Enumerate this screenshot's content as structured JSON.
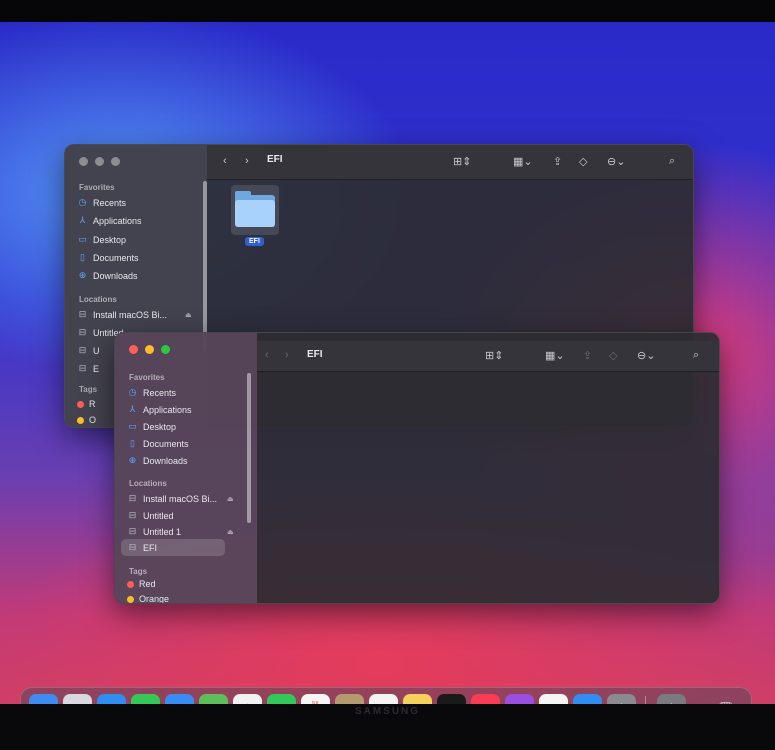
{
  "back_window": {
    "title": "EFI",
    "sidebar": {
      "favorites_header": "Favorites",
      "favorites": [
        {
          "label": "Recents",
          "icon": "clock-icon"
        },
        {
          "label": "Applications",
          "icon": "applications-icon"
        },
        {
          "label": "Desktop",
          "icon": "desktop-icon"
        },
        {
          "label": "Documents",
          "icon": "document-icon"
        },
        {
          "label": "Downloads",
          "icon": "download-icon"
        }
      ],
      "locations_header": "Locations",
      "locations": [
        {
          "label": "Install macOS Bi...",
          "icon": "drive-icon"
        },
        {
          "label": "Untitled",
          "icon": "drive-icon"
        },
        {
          "label": "U",
          "icon": "drive-icon"
        },
        {
          "label": "E",
          "icon": "drive-icon"
        }
      ],
      "tags_header": "Tags",
      "tags": [
        {
          "label": "R",
          "color": "#ff5f57"
        },
        {
          "label": "O",
          "color": "#febb2e"
        }
      ]
    },
    "content": {
      "items": [
        {
          "name": "EFI",
          "icon": "folder-icon",
          "selected": true
        }
      ]
    }
  },
  "front_window": {
    "title": "EFI",
    "sidebar": {
      "favorites_header": "Favorites",
      "favorites": [
        {
          "label": "Recents",
          "icon": "clock-icon"
        },
        {
          "label": "Applications",
          "icon": "applications-icon"
        },
        {
          "label": "Desktop",
          "icon": "desktop-icon"
        },
        {
          "label": "Documents",
          "icon": "document-icon"
        },
        {
          "label": "Downloads",
          "icon": "download-icon"
        }
      ],
      "locations_header": "Locations",
      "locations": [
        {
          "label": "Install macOS Bi...",
          "icon": "drive-icon",
          "ejectable": true
        },
        {
          "label": "Untitled",
          "icon": "drive-icon",
          "ejectable": false
        },
        {
          "label": "Untitled 1",
          "icon": "drive-icon",
          "ejectable": true
        },
        {
          "label": "EFI",
          "icon": "drive-icon",
          "selected": true
        }
      ],
      "tags_header": "Tags",
      "tags": [
        {
          "label": "Red",
          "color": "#ff5f57"
        },
        {
          "label": "Orange",
          "color": "#febb2e"
        }
      ]
    },
    "content": {
      "items": []
    }
  },
  "dock": {
    "apps": [
      {
        "name": "finder-icon",
        "glyph": "☺",
        "color": "#3f8cf0"
      },
      {
        "name": "launchpad-icon",
        "glyph": "▦",
        "color": "#d8d8e0"
      },
      {
        "name": "safari-icon",
        "glyph": "⊘",
        "color": "#2f8ef0"
      },
      {
        "name": "messages-icon",
        "glyph": "✉",
        "color": "#36c759"
      },
      {
        "name": "mail-icon",
        "glyph": "✉",
        "color": "#3a8cf5"
      },
      {
        "name": "maps-icon",
        "glyph": "➤",
        "color": "#5cbf5c"
      },
      {
        "name": "photos-icon",
        "glyph": "✿",
        "color": "#f2f2f2"
      },
      {
        "name": "facetime-icon",
        "glyph": "■",
        "color": "#34c759"
      },
      {
        "name": "calendar-icon",
        "glyph": "21",
        "color": "#f6f6f6"
      },
      {
        "name": "contacts-icon",
        "glyph": "◉",
        "color": "#b59a70"
      },
      {
        "name": "reminders-icon",
        "glyph": "≡",
        "color": "#f4f4f4"
      },
      {
        "name": "notes-icon",
        "glyph": "≡",
        "color": "#f5d05a"
      },
      {
        "name": "tv-icon",
        "glyph": "tv",
        "color": "#1a1a1a"
      },
      {
        "name": "music-icon",
        "glyph": "♫",
        "color": "#fa3c55"
      },
      {
        "name": "podcasts-icon",
        "glyph": "◎",
        "color": "#9a4fe0"
      },
      {
        "name": "news-icon",
        "glyph": "N",
        "color": "#f5f5f5"
      },
      {
        "name": "app-store-icon",
        "glyph": "A",
        "color": "#2f8ef0"
      },
      {
        "name": "system-preferences-icon",
        "glyph": "⚙",
        "color": "#8a8a90"
      }
    ],
    "others": [
      {
        "name": "utility-icon",
        "glyph": "⚙",
        "color": "#7a7a80"
      },
      {
        "name": "trash-icon",
        "glyph": "🗑",
        "color": "#c8c8ce"
      }
    ],
    "calendar_month": "JUL",
    "calendar_day": "21"
  },
  "monitor_brand": "SAMSUNG"
}
